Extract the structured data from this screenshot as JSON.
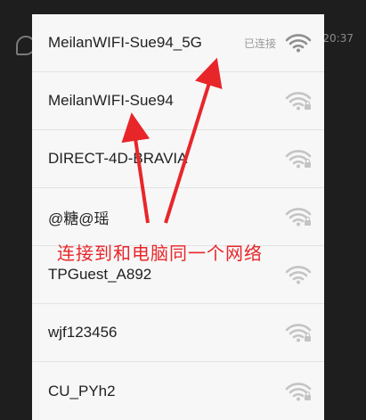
{
  "background": {
    "time": "20:37"
  },
  "wifi_list": {
    "networks": [
      {
        "ssid": "MeilanWIFI-Sue94_5G",
        "status": "已连接",
        "connected": true,
        "secured": false
      },
      {
        "ssid": "MeilanWIFI-Sue94",
        "status": "",
        "connected": false,
        "secured": true
      },
      {
        "ssid": "DIRECT-4D-BRAVIA",
        "status": "",
        "connected": false,
        "secured": true
      },
      {
        "ssid": "@糖@瑶",
        "status": "",
        "connected": false,
        "secured": true
      },
      {
        "ssid": "TPGuest_A892",
        "status": "",
        "connected": false,
        "secured": false
      },
      {
        "ssid": "wjf123456",
        "status": "",
        "connected": false,
        "secured": true
      },
      {
        "ssid": "CU_PYh2",
        "status": "",
        "connected": false,
        "secured": true
      }
    ]
  },
  "annotation": {
    "text": "连接到和电脑同一个网络",
    "color": "#e8262a"
  },
  "colors": {
    "panel": "#f7f7f7",
    "connected_icon": "#8f8f8f",
    "idle_icon": "#c4c4c4"
  }
}
